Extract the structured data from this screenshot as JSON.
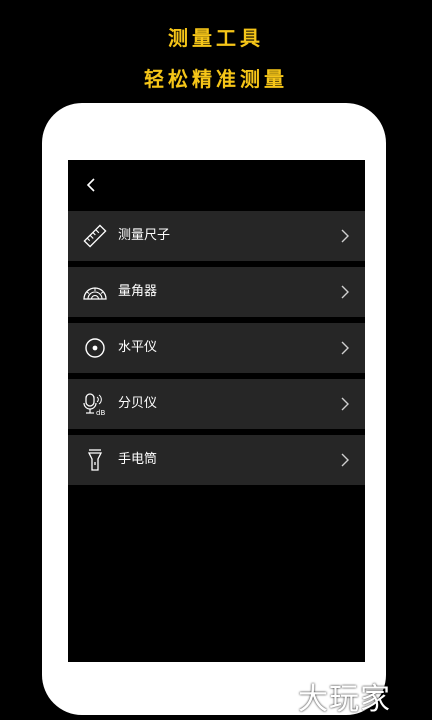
{
  "promo": {
    "line1": "测量工具",
    "line2": "轻松精准测量",
    "accent_color": "#f5c518"
  },
  "header": {
    "back_icon": "back-chevron-icon"
  },
  "menu": {
    "items": [
      {
        "label": "测量尺子",
        "icon": "ruler-icon"
      },
      {
        "label": "量角器",
        "icon": "protractor-icon"
      },
      {
        "label": "水平仪",
        "icon": "level-icon"
      },
      {
        "label": "分贝仪",
        "icon": "decibel-meter-icon"
      },
      {
        "label": "手电筒",
        "icon": "flashlight-icon"
      }
    ],
    "row_color": "#262626",
    "chevron_icon": "chevron-right-icon"
  },
  "watermark": {
    "text": "大玩家"
  }
}
